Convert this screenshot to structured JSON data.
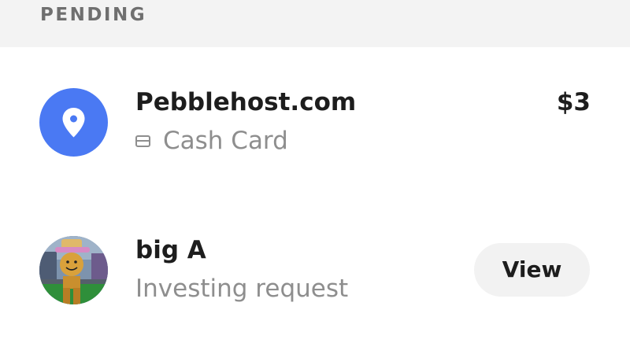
{
  "section": {
    "title": "PENDING"
  },
  "transactions": [
    {
      "name": "Pebblehost.com",
      "method": "Cash Card",
      "amount": "$3",
      "icon": "location-pin-icon",
      "icon_bg": "#4a79f3"
    },
    {
      "name": "big A",
      "description": "Investing request",
      "action_label": "View",
      "avatar": "avatar-photo"
    }
  ],
  "colors": {
    "header_bg": "#f3f3f3",
    "header_text": "#6f6f6f",
    "primary_text": "#1d1d1d",
    "secondary_text": "#8e8e8e",
    "button_bg": "#f2f2f2"
  }
}
